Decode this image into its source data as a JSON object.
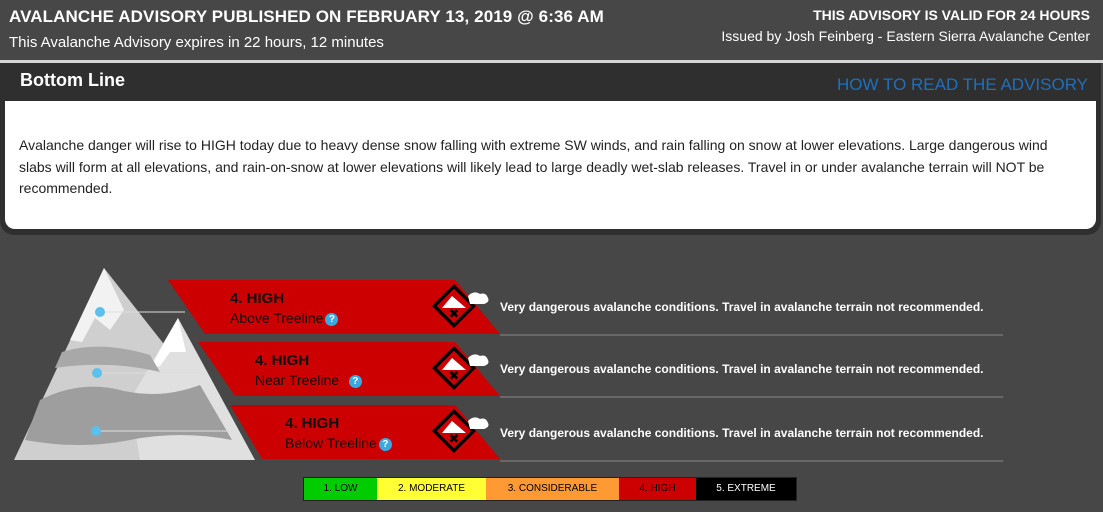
{
  "header": {
    "title": "AVALANCHE ADVISORY PUBLISHED ON FEBRUARY 13, 2019 @ 6:36 AM",
    "expires": "This Avalanche Advisory expires in 22 hours, 12 minutes",
    "valid": "THIS ADVISORY IS VALID FOR 24 HOURS",
    "issued": "Issued by Josh Feinberg - Eastern Sierra Avalanche Center"
  },
  "bottom_line": {
    "title": "Bottom Line",
    "link": "HOW TO READ THE ADVISORY",
    "text": "Avalanche danger will rise to HIGH today due to heavy dense snow falling with extreme SW winds, and rain falling on snow at lower elevations.  Large dangerous wind slabs will form at all elevations, and rain-on-snow at lower elevations will likely lead to large deadly wet-slab releases.  Travel in or under avalanche terrain will NOT be recommended."
  },
  "bands": [
    {
      "level": "4. HIGH",
      "zone": "Above Treeline",
      "description": "Very dangerous avalanche conditions. Travel in avalanche terrain not recommended.",
      "color": "#cc0000"
    },
    {
      "level": "4. HIGH",
      "zone": "Near Treeline",
      "description": "Very dangerous avalanche conditions. Travel in avalanche terrain not recommended.",
      "color": "#cc0000"
    },
    {
      "level": "4. HIGH",
      "zone": "Below Treeline",
      "description": "Very dangerous avalanche conditions. Travel in avalanche terrain not recommended.",
      "color": "#cc0000"
    }
  ],
  "help_glyph": "?",
  "legend": [
    {
      "label": "1. LOW",
      "color": "#00cc00",
      "text_color": "#000000"
    },
    {
      "label": "2. MODERATE",
      "color": "#ffff33",
      "text_color": "#000000"
    },
    {
      "label": "3. CONSIDERABLE",
      "color": "#ff9933",
      "text_color": "#000000"
    },
    {
      "label": "4. HIGH",
      "color": "#cc0000",
      "text_color": "#000000"
    },
    {
      "label": "5. EXTREME",
      "color": "#000000",
      "text_color": "#ffffff"
    }
  ],
  "colors": {
    "link": "#1f6fbd",
    "dot": "#5bc0eb"
  }
}
